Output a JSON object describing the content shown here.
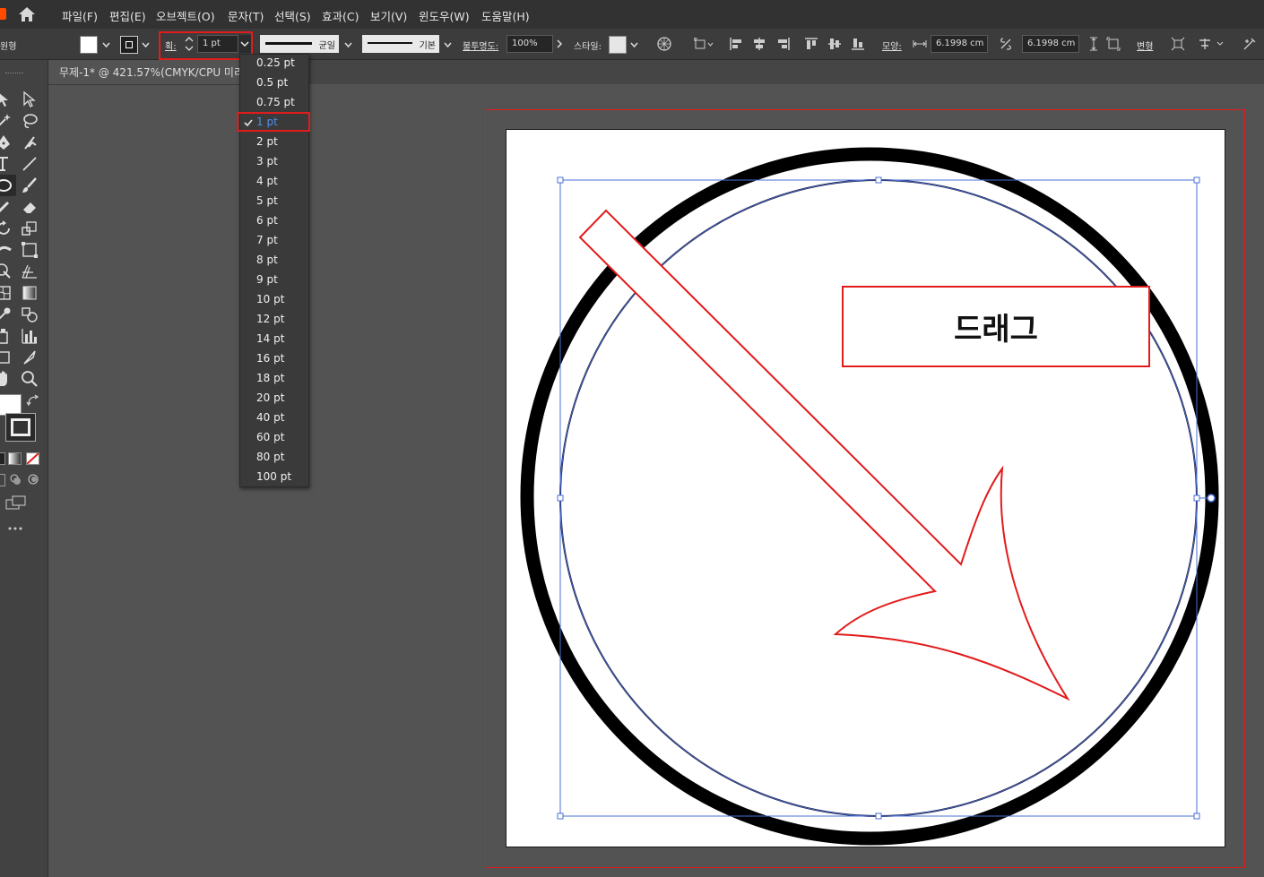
{
  "menu": {
    "items": [
      "파일(F)",
      "편집(E)",
      "오브젝트(O)",
      "문자(T)",
      "선택(S)",
      "효과(C)",
      "보기(V)",
      "윈도우(W)",
      "도움말(H)"
    ]
  },
  "controlbar": {
    "left_label": "원형",
    "stroke_label": "획:",
    "stroke_value": "1 pt",
    "profile_label": "균일",
    "brush_label": "기본",
    "opacity_label": "불투명도:",
    "opacity_value": "100%",
    "style_label": "스타일:",
    "shape_label": "모양:",
    "width_value": "6.1998 cm",
    "height_value": "6.1998 cm",
    "transform_label": "변형"
  },
  "document": {
    "tab_title": "무제-1* @ 421.57%(CMYK/CPU 미리"
  },
  "dropdown": {
    "options": [
      "0.25 pt",
      "0.5 pt",
      "0.75 pt",
      "1 pt",
      "2 pt",
      "3 pt",
      "4 pt",
      "5 pt",
      "6 pt",
      "7 pt",
      "8 pt",
      "9 pt",
      "10 pt",
      "12 pt",
      "14 pt",
      "16 pt",
      "18 pt",
      "20 pt",
      "40 pt",
      "60 pt",
      "80 pt",
      "100 pt"
    ],
    "selected": "1 pt"
  },
  "annotation": {
    "drag_label": "드래그"
  },
  "colors": {
    "highlight": "#e21b1b",
    "selection": "#4a6fd6",
    "panel": "#3c3c3c",
    "canvas": "#535353"
  }
}
